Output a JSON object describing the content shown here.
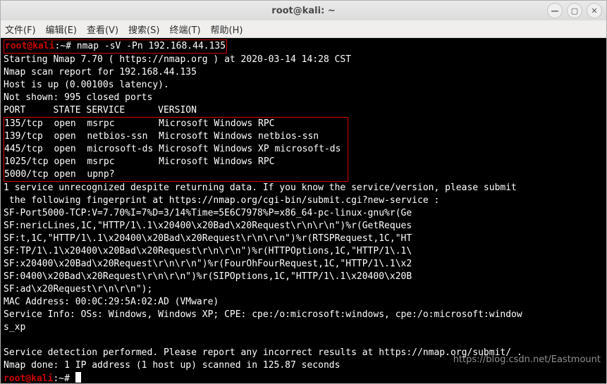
{
  "window": {
    "title": "root@kali: ~"
  },
  "menu": {
    "file": "文件(F)",
    "edit": "编辑(E)",
    "view": "查看(V)",
    "search": "搜索(S)",
    "term": "终端(T)",
    "help": "帮助(H)"
  },
  "prompt": {
    "user": "root@kali",
    "path": "~",
    "symbol": "#"
  },
  "cmd": {
    "nmap": "nmap -sV -Pn 192.168.44.135"
  },
  "out": {
    "l1": "Starting Nmap 7.70 ( https://nmap.org ) at 2020-03-14 14:28 CST",
    "l2": "Nmap scan report for 192.168.44.135",
    "l3": "Host is up (0.00100s latency).",
    "l4": "Not shown: 995 closed ports",
    "l5": "PORT     STATE SERVICE      VERSION",
    "p1": "135/tcp  open  msrpc        Microsoft Windows RPC             ",
    "p2": "139/tcp  open  netbios-ssn  Microsoft Windows netbios-ssn     ",
    "p3": "445/tcp  open  microsoft-ds Microsoft Windows XP microsoft-ds ",
    "p4": "1025/tcp open  msrpc        Microsoft Windows RPC             ",
    "p5": "5000/tcp open  upnp?                                          ",
    "l6": "1 service unrecognized despite returning data. If you know the service/version, please submit",
    "l7": " the following fingerprint at https://nmap.org/cgi-bin/submit.cgi?new-service :",
    "l8": "SF-Port5000-TCP:V=7.70%I=7%D=3/14%Time=5E6C7978%P=x86_64-pc-linux-gnu%r(Ge",
    "l9": "SF:nericLines,1C,\"HTTP/1\\.1\\x20400\\x20Bad\\x20Request\\r\\n\\r\\n\")%r(GetReques",
    "l10": "SF:t,1C,\"HTTP/1\\.1\\x20400\\x20Bad\\x20Request\\r\\n\\r\\n\")%r(RTSPRequest,1C,\"HT",
    "l11": "SF:TP/1\\.1\\x20400\\x20Bad\\x20Request\\r\\n\\r\\n\")%r(HTTPOptions,1C,\"HTTP/1\\.1\\",
    "l12": "SF:x20400\\x20Bad\\x20Request\\r\\n\\r\\n\")%r(FourOhFourRequest,1C,\"HTTP/1\\.1\\x2",
    "l13": "SF:0400\\x20Bad\\x20Request\\r\\n\\r\\n\")%r(SIPOptions,1C,\"HTTP/1\\.1\\x20400\\x20B",
    "l14": "SF:ad\\x20Request\\r\\n\\r\\n\");",
    "l15": "MAC Address: 00:0C:29:5A:02:AD (VMware)",
    "l16": "Service Info: OSs: Windows, Windows XP; CPE: cpe:/o:microsoft:windows, cpe:/o:microsoft:window",
    "l17": "s_xp",
    "l18": "",
    "l19": "Service detection performed. Please report any incorrect results at https://nmap.org/submit/ .",
    "l20": "Nmap done: 1 IP address (1 host up) scanned in 125.87 seconds"
  },
  "watermark": "https://blog.csdn.net/Eastmount"
}
